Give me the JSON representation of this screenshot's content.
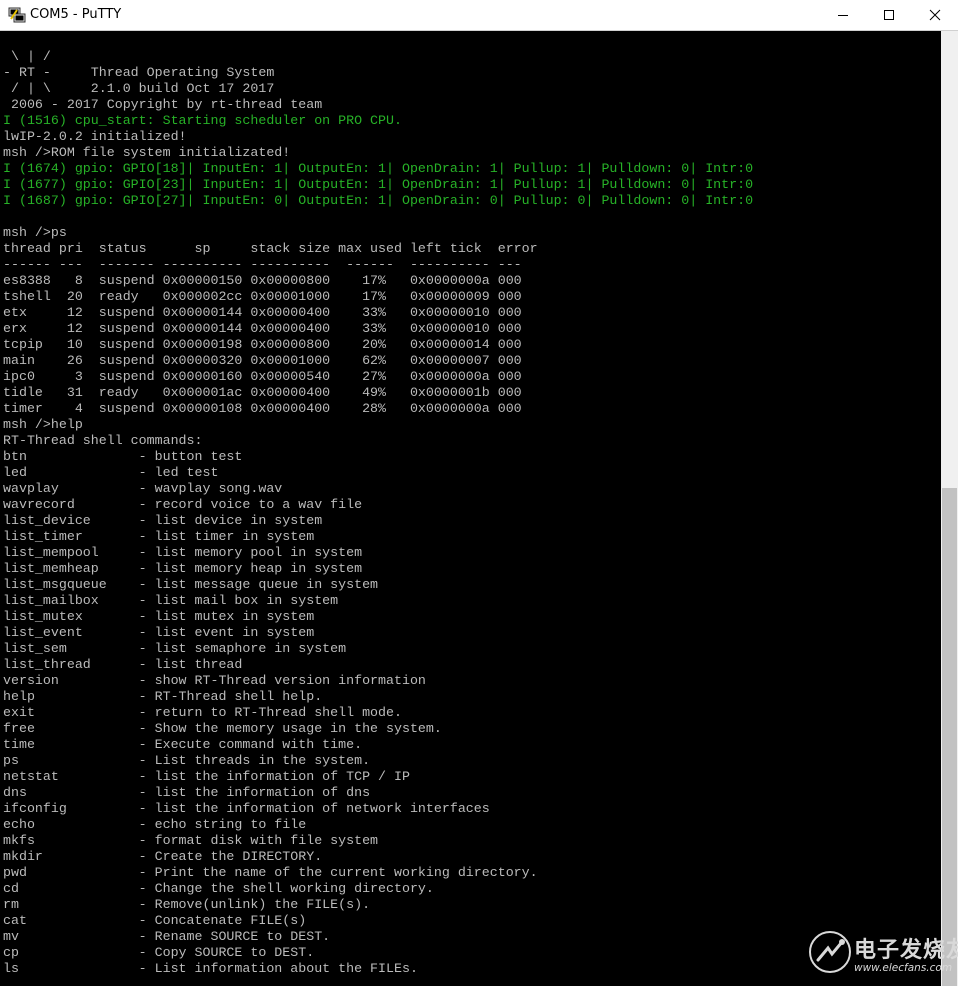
{
  "window": {
    "title": "COM5 - PuTTY",
    "app_icon": "putty-icon",
    "controls": [
      "minimize-icon",
      "maximize-icon",
      "close-icon"
    ]
  },
  "terminal": {
    "colors": {
      "background": "#000000",
      "text": "#bbbbbb",
      "green": "#27b227"
    },
    "lines": [
      {
        "text": " \\ | /",
        "color": "default"
      },
      {
        "text": "- RT -     Thread Operating System",
        "color": "default"
      },
      {
        "text": " / | \\     2.1.0 build Oct 17 2017",
        "color": "default"
      },
      {
        "text": " 2006 - 2017 Copyright by rt-thread team",
        "color": "default"
      },
      {
        "text": "I (1516) cpu_start: Starting scheduler on PRO CPU.",
        "color": "green"
      },
      {
        "text": "lwIP-2.0.2 initialized!",
        "color": "default"
      },
      {
        "text": "msh />ROM file system initializated!",
        "color": "default"
      },
      {
        "text": "I (1674) gpio: GPIO[18]| InputEn: 1| OutputEn: 1| OpenDrain: 1| Pullup: 1| Pulldown: 0| Intr:0",
        "color": "green"
      },
      {
        "text": "I (1677) gpio: GPIO[23]| InputEn: 1| OutputEn: 1| OpenDrain: 1| Pullup: 1| Pulldown: 0| Intr:0",
        "color": "green"
      },
      {
        "text": "I (1687) gpio: GPIO[27]| InputEn: 0| OutputEn: 1| OpenDrain: 0| Pullup: 0| Pulldown: 0| Intr:0",
        "color": "green"
      },
      {
        "text": "",
        "color": "default"
      },
      {
        "text": "msh />ps",
        "color": "default"
      },
      {
        "text": "thread pri  status      sp     stack size max used left tick  error",
        "color": "default"
      },
      {
        "text": "------ ---  ------- ---------- ----------  ------  ---------- ---",
        "color": "default"
      },
      {
        "text": "es8388   8  suspend 0x00000150 0x00000800    17%   0x0000000a 000",
        "color": "default"
      },
      {
        "text": "tshell  20  ready   0x000002cc 0x00001000    17%   0x00000009 000",
        "color": "default"
      },
      {
        "text": "etx     12  suspend 0x00000144 0x00000400    33%   0x00000010 000",
        "color": "default"
      },
      {
        "text": "erx     12  suspend 0x00000144 0x00000400    33%   0x00000010 000",
        "color": "default"
      },
      {
        "text": "tcpip   10  suspend 0x00000198 0x00000800    20%   0x00000014 000",
        "color": "default"
      },
      {
        "text": "main    26  suspend 0x00000320 0x00001000    62%   0x00000007 000",
        "color": "default"
      },
      {
        "text": "ipc0     3  suspend 0x00000160 0x00000540    27%   0x0000000a 000",
        "color": "default"
      },
      {
        "text": "tidle   31  ready   0x000001ac 0x00000400    49%   0x0000001b 000",
        "color": "default"
      },
      {
        "text": "timer    4  suspend 0x00000108 0x00000400    28%   0x0000000a 000",
        "color": "default"
      },
      {
        "text": "msh />help",
        "color": "default"
      },
      {
        "text": "RT-Thread shell commands:",
        "color": "default"
      },
      {
        "text": "btn              - button test",
        "color": "default"
      },
      {
        "text": "led              - led test",
        "color": "default"
      },
      {
        "text": "wavplay          - wavplay song.wav",
        "color": "default"
      },
      {
        "text": "wavrecord        - record voice to a wav file",
        "color": "default"
      },
      {
        "text": "list_device      - list device in system",
        "color": "default"
      },
      {
        "text": "list_timer       - list timer in system",
        "color": "default"
      },
      {
        "text": "list_mempool     - list memory pool in system",
        "color": "default"
      },
      {
        "text": "list_memheap     - list memory heap in system",
        "color": "default"
      },
      {
        "text": "list_msgqueue    - list message queue in system",
        "color": "default"
      },
      {
        "text": "list_mailbox     - list mail box in system",
        "color": "default"
      },
      {
        "text": "list_mutex       - list mutex in system",
        "color": "default"
      },
      {
        "text": "list_event       - list event in system",
        "color": "default"
      },
      {
        "text": "list_sem         - list semaphore in system",
        "color": "default"
      },
      {
        "text": "list_thread      - list thread",
        "color": "default"
      },
      {
        "text": "version          - show RT-Thread version information",
        "color": "default"
      },
      {
        "text": "help             - RT-Thread shell help.",
        "color": "default"
      },
      {
        "text": "exit             - return to RT-Thread shell mode.",
        "color": "default"
      },
      {
        "text": "free             - Show the memory usage in the system.",
        "color": "default"
      },
      {
        "text": "time             - Execute command with time.",
        "color": "default"
      },
      {
        "text": "ps               - List threads in the system.",
        "color": "default"
      },
      {
        "text": "netstat          - list the information of TCP / IP",
        "color": "default"
      },
      {
        "text": "dns              - list the information of dns",
        "color": "default"
      },
      {
        "text": "ifconfig         - list the information of network interfaces",
        "color": "default"
      },
      {
        "text": "echo             - echo string to file",
        "color": "default"
      },
      {
        "text": "mkfs             - format disk with file system",
        "color": "default"
      },
      {
        "text": "mkdir            - Create the DIRECTORY.",
        "color": "default"
      },
      {
        "text": "pwd              - Print the name of the current working directory.",
        "color": "default"
      },
      {
        "text": "cd               - Change the shell working directory.",
        "color": "default"
      },
      {
        "text": "rm               - Remove(unlink) the FILE(s).",
        "color": "default"
      },
      {
        "text": "cat              - Concatenate FILE(s)",
        "color": "default"
      },
      {
        "text": "mv               - Rename SOURCE to DEST.",
        "color": "default"
      },
      {
        "text": "cp               - Copy SOURCE to DEST.",
        "color": "default"
      },
      {
        "text": "ls               - List information about the FILEs.",
        "color": "default"
      }
    ]
  },
  "watermark": {
    "brand": "电子发烧友",
    "url": "www.elecfans.com",
    "logo_icon": "elecfans-logo-icon"
  }
}
